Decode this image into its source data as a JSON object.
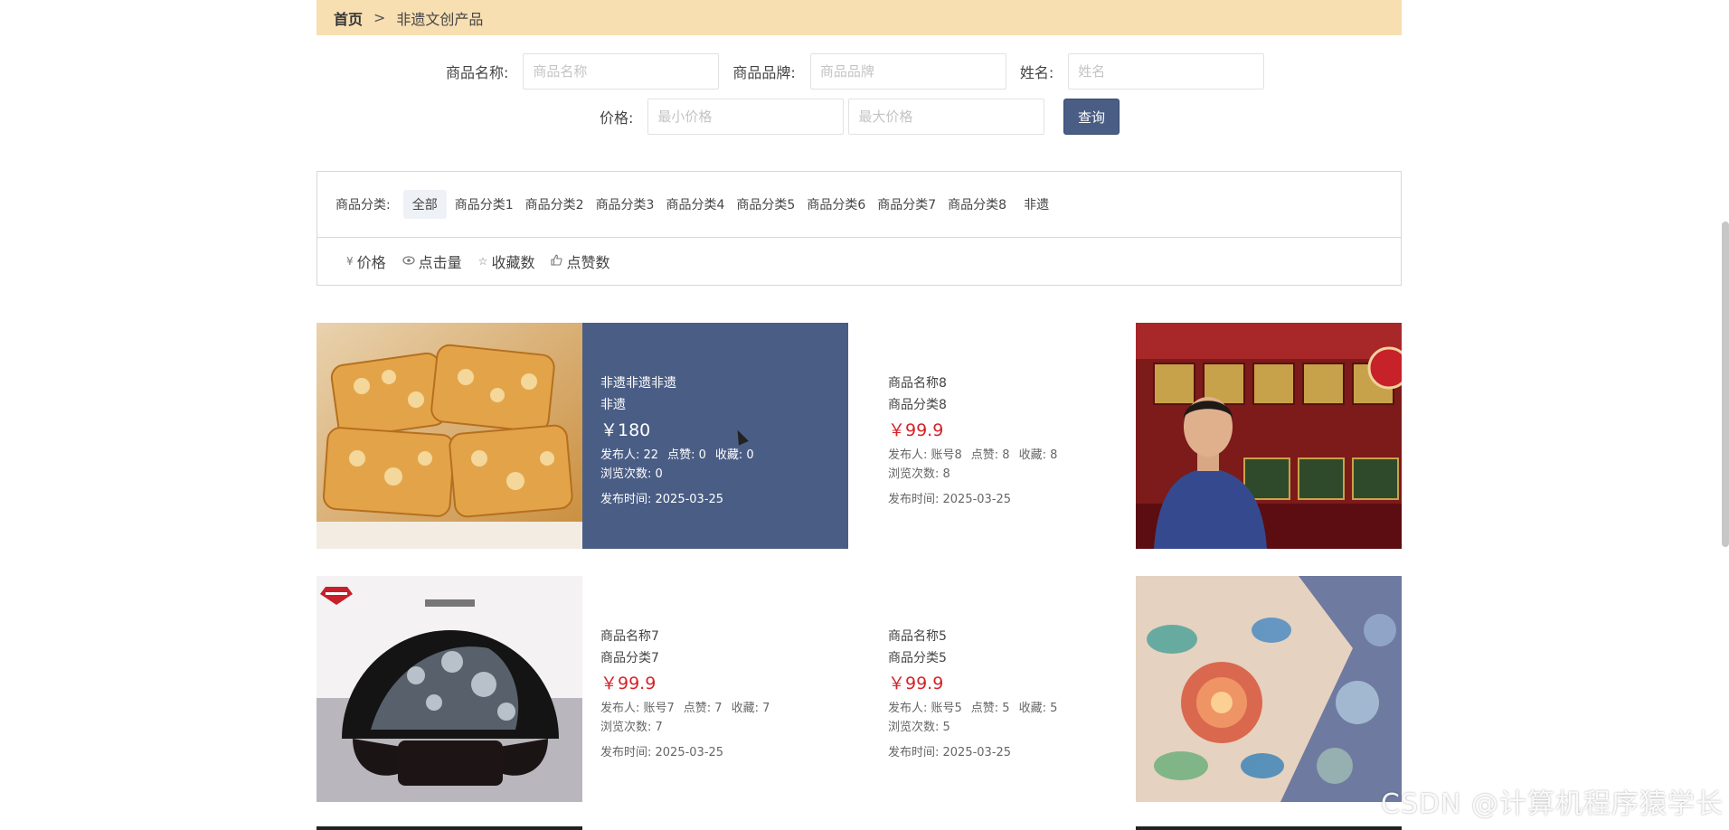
{
  "breadcrumb": {
    "home": "首页",
    "sep": ">",
    "current": "非遗文创产品"
  },
  "search": {
    "name_label": "商品名称:",
    "name_placeholder": "商品名称",
    "brand_label": "商品品牌:",
    "brand_placeholder": "商品品牌",
    "person_label": "姓名:",
    "person_placeholder": "姓名",
    "price_label": "价格:",
    "min_placeholder": "最小价格",
    "max_placeholder": "最大价格",
    "query_button": "查询"
  },
  "categories": {
    "label": "商品分类:",
    "items": [
      "全部",
      "商品分类1",
      "商品分类2",
      "商品分类3",
      "商品分类4",
      "商品分类5",
      "商品分类6",
      "商品分类7",
      "商品分类8",
      "非遗"
    ],
    "active": "全部"
  },
  "sort": {
    "items": [
      {
        "icon": "yen-icon",
        "label": "价格"
      },
      {
        "icon": "eye-icon",
        "label": "点击量"
      },
      {
        "icon": "star-icon",
        "label": "收藏数"
      },
      {
        "icon": "thumbs-up-icon",
        "label": "点赞数"
      }
    ]
  },
  "products": [
    {
      "name": "非遗非遗非遗",
      "category": "非遗",
      "price": "￥180",
      "publisher": "发布人:  22",
      "likes": "点赞:  0",
      "favorites": "收藏:  0",
      "views": "浏览次数:  0",
      "time": "发布时间:  2025-03-25",
      "image": "peanut-brittle-image"
    },
    {
      "name": "商品名称8",
      "category": "商品分类8",
      "price": "￥99.9",
      "publisher": "发布人:  账号8",
      "likes": "点赞:  8",
      "favorites": "收藏:  8",
      "views": "浏览次数:  8",
      "time": "发布时间:  2025-03-25",
      "image": "man-in-red-hall-image"
    },
    {
      "name": "商品名称7",
      "category": "商品分类7",
      "price": "￥99.9",
      "publisher": "发布人:  账号7",
      "likes": "点赞:  7",
      "favorites": "收藏:  7",
      "views": "浏览次数:  7",
      "time": "发布时间:  2025-03-25",
      "image": "lacquer-screen-peacock-image"
    },
    {
      "name": "商品名称5",
      "category": "商品分类5",
      "price": "￥99.9",
      "publisher": "发布人:  账号5",
      "likes": "点赞:  5",
      "favorites": "收藏:  5",
      "views": "浏览次数:  5",
      "time": "发布时间:  2025-03-25",
      "image": "mother-of-pearl-box-image"
    }
  ],
  "watermark": "CSDN @计算机程序猿学长",
  "colors": {
    "accent": "#4a5d85",
    "breadcrumb_bg": "#f8dfb2",
    "price": "#d3242a"
  }
}
